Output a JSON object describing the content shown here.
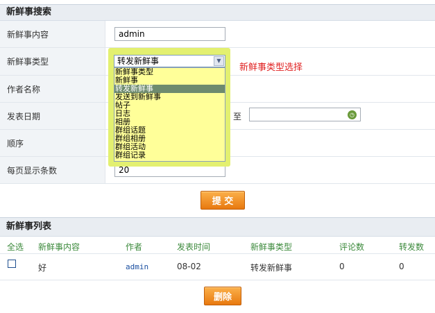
{
  "search": {
    "title": "新鲜事搜索",
    "content_label": "新鲜事内容",
    "content_value": "admin",
    "type_label": "新鲜事类型",
    "type_selected": "转发新鲜事",
    "type_options": [
      "新鲜事类型",
      "新鲜事",
      "转发新鲜事",
      "发送到新鲜事",
      "帖子",
      "日志",
      "相册",
      "群组话题",
      "群组相册",
      "群组活动",
      "群组记录"
    ],
    "type_hint": "新鲜事类型选择",
    "author_label": "作者名称",
    "date_label": "发表日期",
    "date_to": "至",
    "order_label": "顺序",
    "per_page_label": "每页显示条数",
    "per_page_value": "20",
    "submit_label": "提 交"
  },
  "list": {
    "title": "新鲜事列表",
    "columns": [
      "全选",
      "新鲜事内容",
      "作者",
      "发表时间",
      "新鲜事类型",
      "评论数",
      "转发数"
    ],
    "rows": [
      {
        "content": "好",
        "author": "admin",
        "time": "08-02",
        "type": "转发新鲜事",
        "comments": "0",
        "forwards": "0"
      }
    ],
    "delete_label": "删除"
  },
  "colors": {
    "accent": "#f39a25",
    "hint": "#e02020",
    "column_header": "#3c8a3c",
    "highlight": "#e3f070"
  },
  "icons": {
    "dropdown": "chevron-down-icon",
    "date_picker": "clock-icon"
  }
}
